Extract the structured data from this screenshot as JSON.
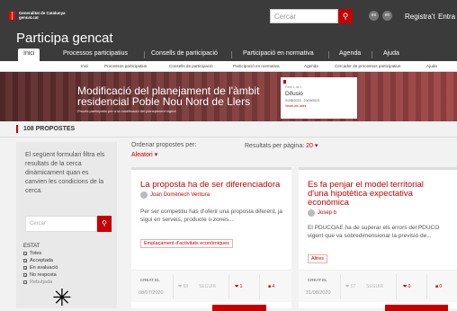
{
  "header": {
    "brand_line1": "Generalitat de Catalunya",
    "brand_line2": "gencat.cat",
    "search_placeholder": "Cercar",
    "lang1": "es",
    "lang2": "en",
    "register": "Registra't",
    "login": "Entra",
    "app_title": "Participa gencat"
  },
  "mainnav": [
    "Inici",
    "Processos participatius",
    "Consells de participació",
    "Participació en normativa",
    "Agenda",
    "Ajuda"
  ],
  "subnav": [
    "Inici",
    "Processos participatius",
    "Consells de participació",
    "Participació en normativa",
    "Agenda",
    "Cercador de processos participatius",
    "Ajuda"
  ],
  "banner": {
    "title": "Modificació del planejament de l'àmbit residencial Poble Nou Nord de Llers",
    "desc": "Procés participatiu per a la modificació del planejament vigent",
    "phase_label": "Fase 1 de 1",
    "phase": "Difusió",
    "dates": "01/08/2023 - 20/09/2023",
    "phases_link": "Veure-les totes"
  },
  "proposals_count": "108 PROPOSTES",
  "filter": {
    "intro": "El següent formulari filtra els resultats de la cerca dinàmicament quan es canvien les condicions de la cerca.",
    "search_placeholder": "Cercar",
    "estat_label": "ESTAT",
    "options": [
      {
        "label": "Totes",
        "checked": true
      },
      {
        "label": "Acceptada",
        "checked": true
      },
      {
        "label": "En avaluació",
        "checked": true
      },
      {
        "label": "No resposta",
        "checked": true
      },
      {
        "label": "Rebutjada",
        "checked": false
      }
    ]
  },
  "sort": {
    "label": "Ordenar propostes per:",
    "value": "Aleatori"
  },
  "perpage": {
    "label": "Resultats per pàgina:",
    "value": "20"
  },
  "cards": [
    {
      "title": "La proposta ha de ser diferenciadora",
      "author": "Joan Domènech Ventura",
      "body": "Per ser competitiu has d'oferir una proposta diferent, ja sigui en serveis, producte o zones...",
      "tag": "Emplaçament d'activitats econòmiques",
      "created_label": "CREAT EL",
      "date": "08/07/2020",
      "supports": "58",
      "follow": "SEGUIR",
      "endorse": "1",
      "comments": "4"
    },
    {
      "title": "Es fa penjar el model territorial d'una hipotètica expectativa econòmica",
      "author": "Josep b",
      "body": "El PDUCOAE ha de superar els errors del PDUCO vigent que va sobredimensionar la previsió de...",
      "tag": "Altres",
      "created_label": "CREAT EL",
      "date": "31/08/2020",
      "supports": "57",
      "follow": "SEGUIR",
      "endorse": "0",
      "comments": "0"
    }
  ]
}
